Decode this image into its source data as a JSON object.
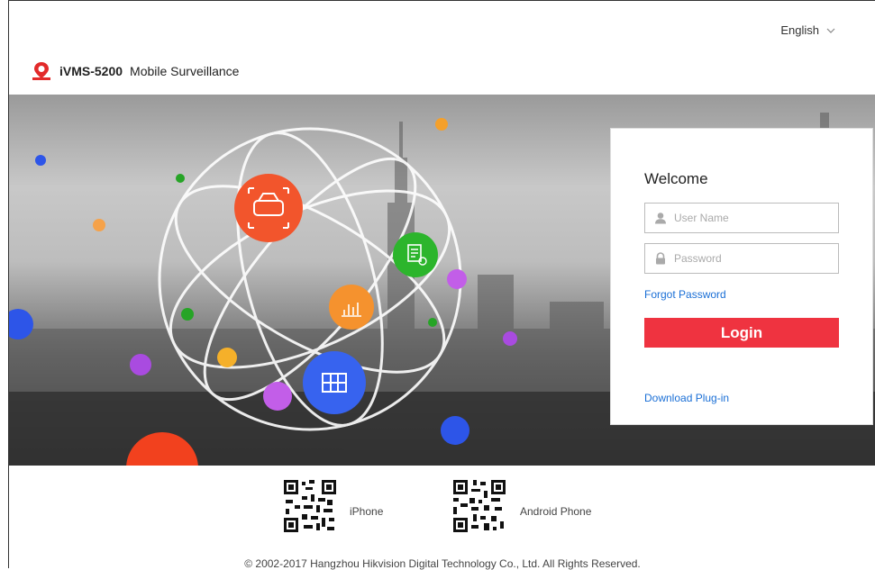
{
  "header": {
    "language": "English",
    "brand_bold": "iVMS-5200",
    "brand_rest": "Mobile Surveillance"
  },
  "login": {
    "welcome": "Welcome",
    "username_placeholder": "User Name",
    "password_placeholder": "Password",
    "forgot": "Forgot Password",
    "login_button": "Login",
    "download": "Download Plug-in"
  },
  "footer": {
    "qr_iphone_label": "iPhone",
    "qr_android_label": "Android Phone",
    "copyright": "© 2002-2017 Hangzhou Hikvision Digital Technology Co., Ltd. All Rights Reserved."
  },
  "icons": [
    "car-icon",
    "alarm-doc-icon",
    "chart-icon",
    "map-icon",
    "user-icon",
    "lock-icon",
    "chevron-down-icon",
    "logo-icon",
    "qr-code-icon"
  ],
  "colors": {
    "accent": "#ef3340",
    "link": "#1a6fd6",
    "orange_node": "#f26a2e",
    "green_node": "#2fb52f",
    "amber_node": "#f59a2a",
    "blue_node": "#3b6cf2"
  }
}
